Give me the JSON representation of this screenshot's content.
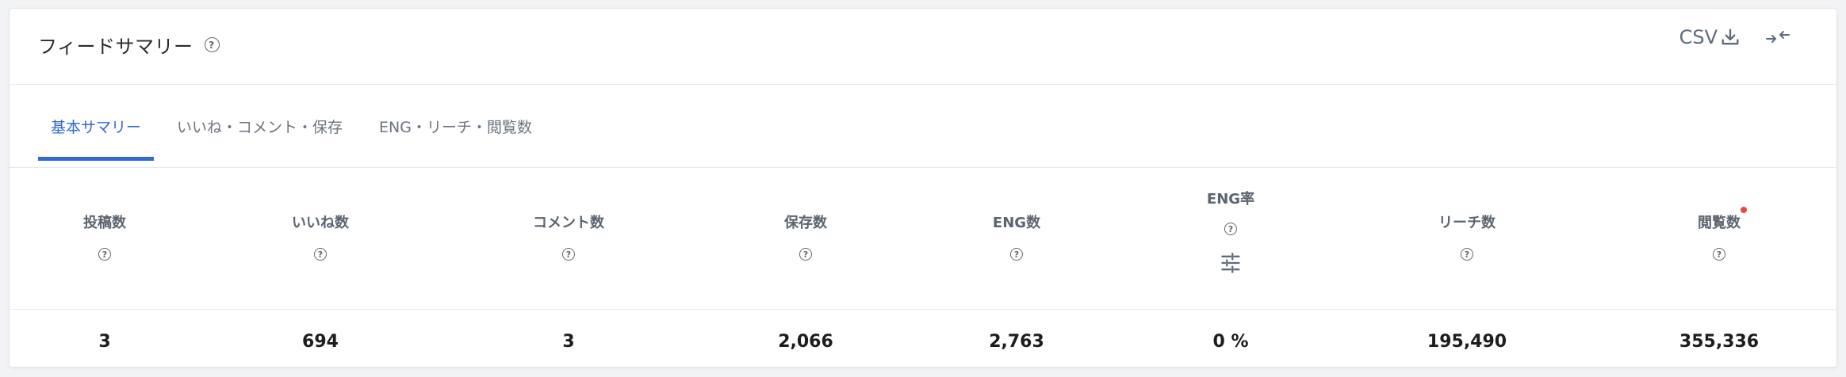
{
  "header": {
    "title": "フィードサマリー",
    "csv_label": "CSV",
    "icons": [
      "help-icon",
      "download-icon",
      "collapse-icon"
    ]
  },
  "tabs": [
    {
      "label": "基本サマリー",
      "active": true
    },
    {
      "label": "いいね・コメント・保存",
      "active": false
    },
    {
      "label": "ENG・リーチ・閲覧数",
      "active": false
    }
  ],
  "metrics": [
    {
      "label": "投稿数",
      "value": "3"
    },
    {
      "label": "いいね数",
      "value": "694"
    },
    {
      "label": "コメント数",
      "value": "3"
    },
    {
      "label": "保存数",
      "value": "2,066"
    },
    {
      "label": "ENG数",
      "value": "2,763"
    },
    {
      "label": "ENG率",
      "value": "0 %"
    },
    {
      "label": "リーチ数",
      "value": "195,490"
    },
    {
      "label": "閲覧数",
      "value": "355,336"
    }
  ],
  "colors": {
    "accent": "#3269d4",
    "notification_dot": "#e04b3a"
  }
}
